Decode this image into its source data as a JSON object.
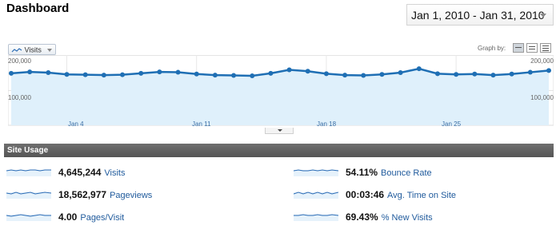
{
  "header": {
    "title": "Dashboard"
  },
  "date_range": {
    "label": "Jan 1, 2010 - Jan 31, 2010"
  },
  "graph": {
    "metric_selector": "Visits",
    "graph_by_label": "Graph by:",
    "y_top_label": "200,000",
    "y_mid_label": "100,000",
    "x_labels": [
      "Jan 4",
      "Jan 11",
      "Jan 18",
      "Jan 25"
    ]
  },
  "chart_data": {
    "type": "area",
    "series": [
      {
        "values": [
          148000,
          152000,
          150000,
          145000,
          144000,
          143000,
          144000,
          148000,
          152000,
          151000,
          146000,
          143000,
          142000,
          141000,
          148000,
          158000,
          154000,
          147000,
          143000,
          142000,
          145000,
          150000,
          161000,
          147000,
          145000,
          146000,
          143000,
          146000,
          151000,
          156000
        ]
      }
    ],
    "ylim": [
      0,
      200000
    ],
    "grid": true,
    "colors": {
      "line": "#1f6fb4",
      "fill": "#dff0fb"
    }
  },
  "site_usage": {
    "title": "Site Usage",
    "metrics": [
      {
        "value": "4,645,244",
        "label": "Visits"
      },
      {
        "value": "54.11%",
        "label": "Bounce Rate"
      },
      {
        "value": "18,562,977",
        "label": "Pageviews"
      },
      {
        "value": "00:03:46",
        "label": "Avg. Time on Site"
      },
      {
        "value": "4.00",
        "label": "Pages/Visit"
      },
      {
        "value": "69.43%",
        "label": "% New Visits"
      }
    ]
  }
}
